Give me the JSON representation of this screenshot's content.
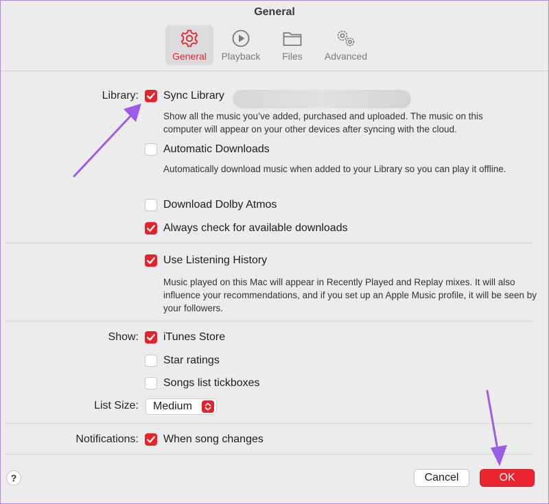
{
  "window": {
    "title": "General"
  },
  "tabs": [
    {
      "label": "General",
      "icon": "gear-icon",
      "active": true
    },
    {
      "label": "Playback",
      "icon": "play-icon",
      "active": false
    },
    {
      "label": "Files",
      "icon": "folder-icon",
      "active": false
    },
    {
      "label": "Advanced",
      "icon": "gears-icon",
      "active": false
    }
  ],
  "library": {
    "label": "Library:",
    "sync": {
      "label": "Sync Library",
      "checked": true,
      "description": "Show all the music you’ve added, purchased and uploaded. The music on this computer will appear on your other devices after syncing with the cloud."
    },
    "auto_downloads": {
      "label": "Automatic Downloads",
      "checked": false,
      "description": "Automatically download music when added to your Library so you can play it offline."
    },
    "dolby": {
      "label": "Download Dolby Atmos",
      "checked": false
    },
    "always_check": {
      "label": "Always check for available downloads",
      "checked": true
    }
  },
  "history": {
    "label": "Use Listening History",
    "checked": true,
    "description": "Music played on this Mac will appear in Recently Played and Replay mixes. It will also influence your recommendations, and if you set up an Apple Music profile, it will be seen by your followers."
  },
  "show": {
    "label": "Show:",
    "itunes_store": {
      "label": "iTunes Store",
      "checked": true
    },
    "star_ratings": {
      "label": "Star ratings",
      "checked": false
    },
    "tickboxes": {
      "label": "Songs list tickboxes",
      "checked": false
    }
  },
  "list_size": {
    "label": "List Size:",
    "value": "Medium"
  },
  "notifications": {
    "label": "Notifications:",
    "song_changes": {
      "label": "When song changes",
      "checked": true
    }
  },
  "footer": {
    "help": "?",
    "cancel": "Cancel",
    "ok": "OK"
  },
  "colors": {
    "accent": "#e4232b",
    "annotation_arrow": "#9b5de5"
  }
}
